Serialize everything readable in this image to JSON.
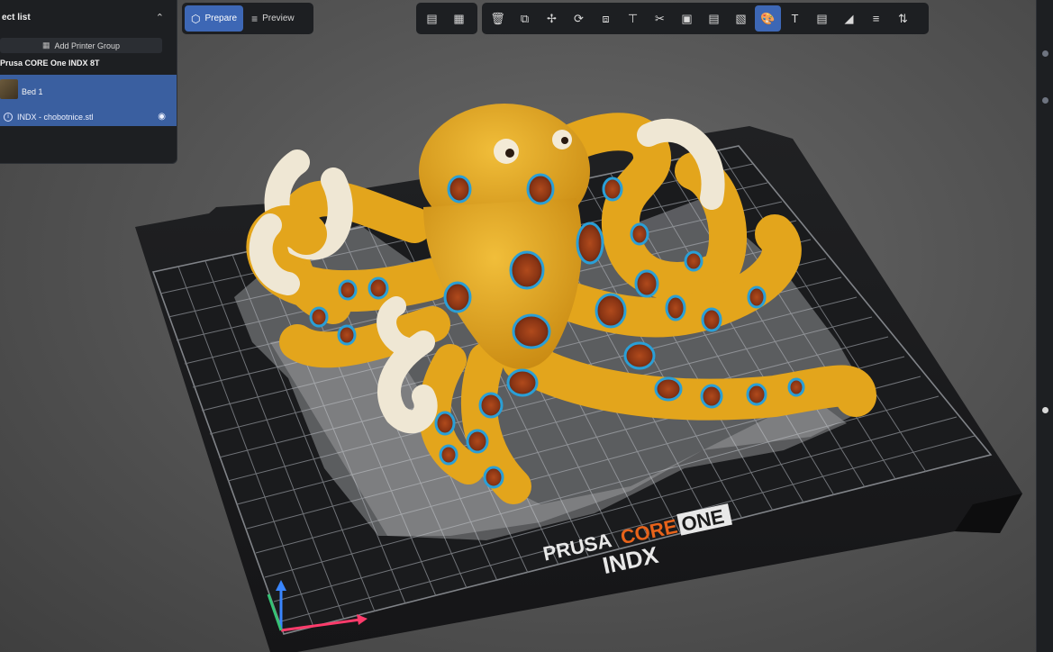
{
  "object_list": {
    "title": "ect list",
    "add_group_label": "Add Printer Group",
    "printer_name": "Prusa CORE One INDX 8T",
    "bed_label": "Bed 1",
    "file_label": "INDX - chobotnice.stl"
  },
  "modes": {
    "prepare_label": "Prepare",
    "preview_label": "Preview",
    "active": "prepare"
  },
  "toolbar_small": [
    "import-icon",
    "arrange-icon"
  ],
  "toolbar_main": [
    "delete-icon",
    "copy-icon",
    "move-icon",
    "rotate-icon",
    "scale-icon",
    "place-on-face-icon",
    "cut-icon",
    "support-icon",
    "seam-icon",
    "fuzzy-icon",
    "paint-icon",
    "text-icon",
    "layers-icon",
    "measure-icon",
    "assembly-icon",
    "variable-height-icon"
  ],
  "active_tool": "paint-icon",
  "bed": {
    "brand_text_1": "PRUSA",
    "brand_text_2": "CORE",
    "brand_text_3": "ONE",
    "brand_text_4": "INDX"
  },
  "colors": {
    "accent": "#3d67b5",
    "panel": "#1d1f22",
    "octopus_body": "#e3a51c",
    "octopus_ring": "#2a9fd6",
    "brand_orange": "#e8631a"
  }
}
